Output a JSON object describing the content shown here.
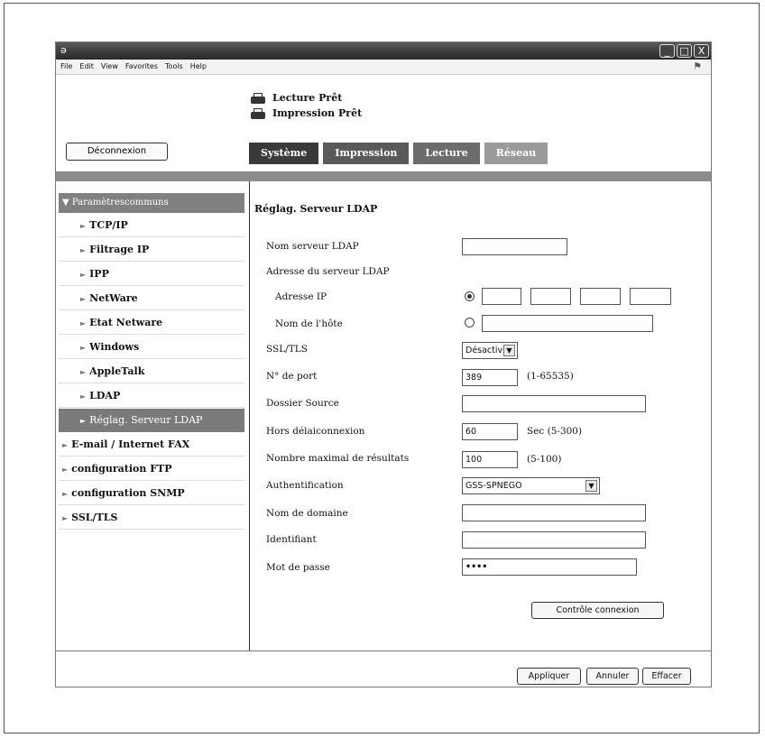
{
  "menu": [
    "File",
    "Edit",
    "View",
    "Favorites",
    "Tools",
    "Help"
  ],
  "window_controls": {
    "minimize": "_",
    "maximize": "□",
    "close": "X"
  },
  "status": [
    "Lecture Prêt",
    "Impression Prêt"
  ],
  "logout_label": "Déconnexion",
  "tabs": [
    "Système",
    "Impression",
    "Lecture",
    "Réseau"
  ],
  "sidebar": {
    "header": "Paramètrescommuns",
    "items": [
      "TCP/IP",
      "Filtrage IP",
      "IPP",
      "NetWare",
      "Etat Netware",
      "Windows",
      "AppleTalk",
      "LDAP",
      "Réglag. Serveur LDAP",
      "E-mail / Internet FAX",
      "configuration FTP",
      "configuration SNMP",
      "SSL/TLS"
    ]
  },
  "form": {
    "title": "Réglag. Serveur LDAP",
    "server_name_label": "Nom serveur LDAP",
    "server_address_label": "Adresse du serveur LDAP",
    "ip_label": "Adresse IP",
    "host_label": "Nom de l'hôte",
    "ssl_label": "SSL/TLS",
    "ssl_value": "Désactiver",
    "port_label": "N° de port",
    "port_value": "389",
    "port_hint": "(1-65535)",
    "source_label": "Dossier Source",
    "timeout_label": "Hors délaiconnexion",
    "timeout_value": "60",
    "timeout_hint": "Sec (5-300)",
    "max_results_label": "Nombre maximal de résultats",
    "max_results_value": "100",
    "max_results_hint": "(5-100)",
    "auth_label": "Authentification",
    "auth_value": "GSS-SPNEGO",
    "domain_label": "Nom de domaine",
    "id_label": "Identifiant",
    "password_label": "Mot de passe",
    "password_value": "••••",
    "check_button": "Contrôle connexion"
  },
  "footer": {
    "apply": "Appliquer",
    "cancel": "Annuler",
    "clear": "Effacer"
  }
}
